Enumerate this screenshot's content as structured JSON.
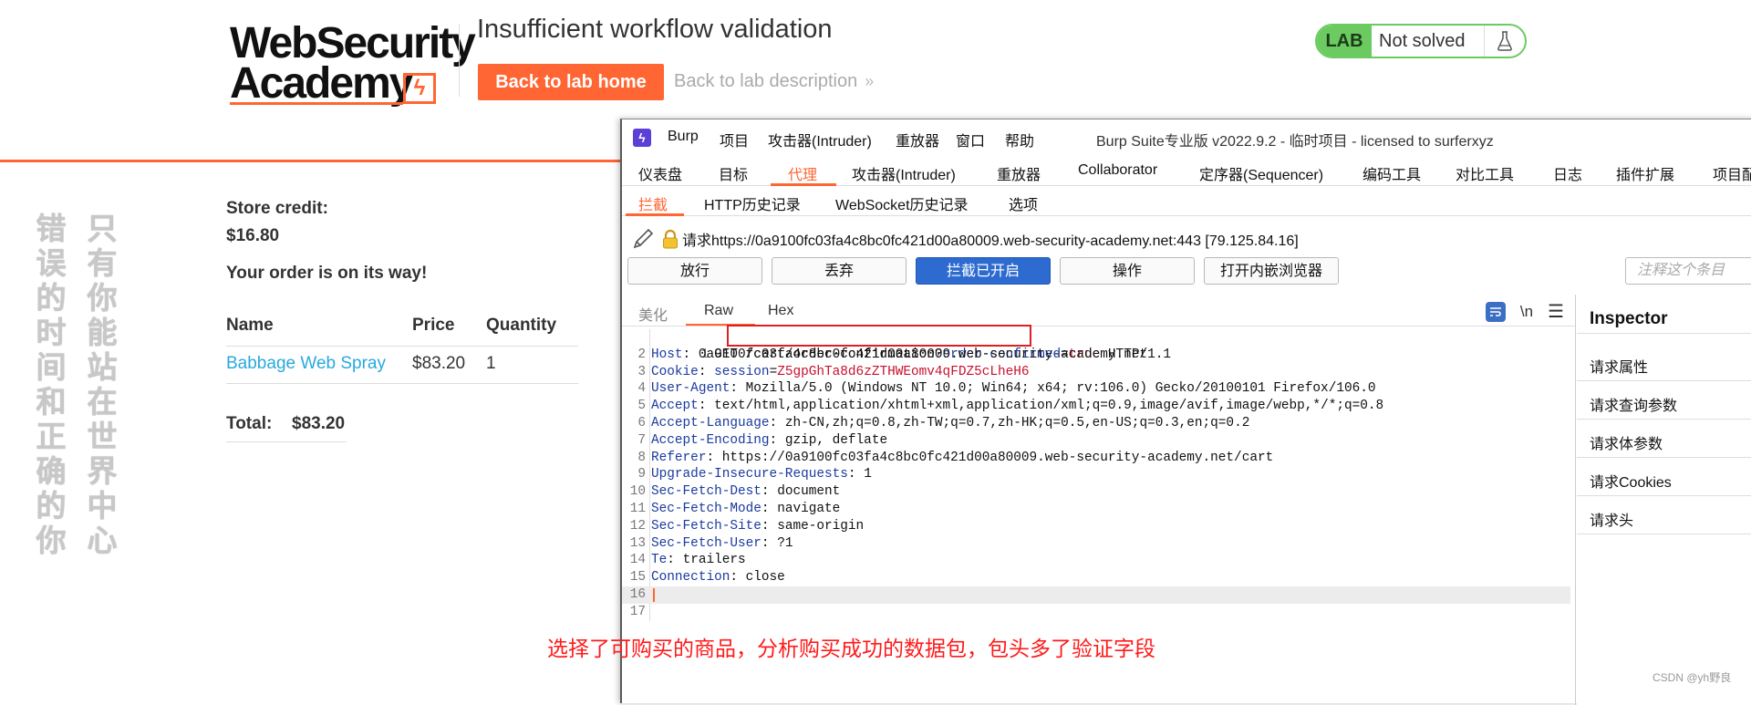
{
  "lab": {
    "logo_line1": "WebSecurity",
    "logo_line2": "Academy",
    "title": "Insufficient workflow validation",
    "back_home": "Back to lab home",
    "back_desc": "Back to lab description",
    "status_tag": "LAB",
    "status_text": "Not solved",
    "store_credit_label": "Store credit:",
    "store_credit_value": "$16.80",
    "order_message": "Your order is on its way!",
    "table": {
      "headers": [
        "Name",
        "Price",
        "Quantity"
      ],
      "rows": [
        {
          "name": "Babbage Web Spray",
          "price": "$83.20",
          "quantity": "1"
        }
      ]
    },
    "total_label": "Total:",
    "total_value": "$83.20",
    "brand_color": "#ff6633",
    "status_color": "#6bcb61"
  },
  "vertical_text": {
    "col1": "错误的时间和正确的你",
    "col2": "只有你能站在世界中心"
  },
  "burp": {
    "menu": [
      "Burp",
      "项目",
      "攻击器(Intruder)",
      "重放器",
      "窗口",
      "帮助"
    ],
    "window_title": "Burp Suite专业版  v2022.9.2 - 临时项目 - licensed to surferxyz",
    "tabs": [
      "仪表盘",
      "目标",
      "代理",
      "攻击器(Intruder)",
      "重放器",
      "Collaborator",
      "定序器(Sequencer)",
      "编码工具",
      "对比工具",
      "日志",
      "插件扩展",
      "项目配"
    ],
    "active_tab": "代理",
    "subtabs": [
      "拦截",
      "HTTP历史记录",
      "WebSocket历史记录",
      "选项"
    ],
    "active_subtab": "拦截",
    "request_line": "请求https://0a9100fc03fa4c8bc0fc421d00a80009.web-security-academy.net:443  [79.125.84.16]",
    "buttons": {
      "forward": "放行",
      "drop": "丢弃",
      "intercept": "拦截已开启",
      "action": "操作",
      "browser": "打开内嵌浏览器"
    },
    "comment_placeholder": "注释这个条目",
    "editor_tabs": [
      "美化",
      "Raw",
      "Hex"
    ],
    "active_editor_tab": "Raw",
    "newline_icon": "\\n",
    "request": [
      {
        "n": "1",
        "text": "GET /cart/order-confirmation?order-confirmed=true HTTP/1.1"
      },
      {
        "n": "2",
        "key": "Host",
        "value": "0a9100fc03fa4c8bc0fc421d00a80009.web-security-academy.net"
      },
      {
        "n": "3",
        "key": "Cookie",
        "value": "session=Z5gpGhTa8d6zZTHWEomv4qFDZ5cLheH6"
      },
      {
        "n": "4",
        "key": "User-Agent",
        "value": "Mozilla/5.0 (Windows NT 10.0; Win64; x64; rv:106.0) Gecko/20100101 Firefox/106.0"
      },
      {
        "n": "5",
        "key": "Accept",
        "value": "text/html,application/xhtml+xml,application/xml;q=0.9,image/avif,image/webp,*/*;q=0.8"
      },
      {
        "n": "6",
        "key": "Accept-Language",
        "value": "zh-CN,zh;q=0.8,zh-TW;q=0.7,zh-HK;q=0.5,en-US;q=0.3,en;q=0.2"
      },
      {
        "n": "7",
        "key": "Accept-Encoding",
        "value": "gzip, deflate"
      },
      {
        "n": "8",
        "key": "Referer",
        "value": "https://0a9100fc03fa4c8bc0fc421d00a80009.web-security-academy.net/cart"
      },
      {
        "n": "9",
        "key": "Upgrade-Insecure-Requests",
        "value": "1"
      },
      {
        "n": "10",
        "key": "Sec-Fetch-Dest",
        "value": "document"
      },
      {
        "n": "11",
        "key": "Sec-Fetch-Mode",
        "value": "navigate"
      },
      {
        "n": "12",
        "key": "Sec-Fetch-Site",
        "value": "same-origin"
      },
      {
        "n": "13",
        "key": "Sec-Fetch-User",
        "value": "?1"
      },
      {
        "n": "14",
        "key": "Te",
        "value": "trailers"
      },
      {
        "n": "15",
        "key": "Connection",
        "value": "close"
      },
      {
        "n": "16",
        "text": ""
      },
      {
        "n": "17",
        "text": ""
      }
    ],
    "inspector": {
      "title": "Inspector",
      "items": [
        "请求属性",
        "请求查询参数",
        "请求体参数",
        "请求Cookies",
        "请求头"
      ]
    }
  },
  "annotation": "选择了可购买的商品，分析购买成功的数据包，包头多了验证字段",
  "watermark": "CSDN @yh野良"
}
